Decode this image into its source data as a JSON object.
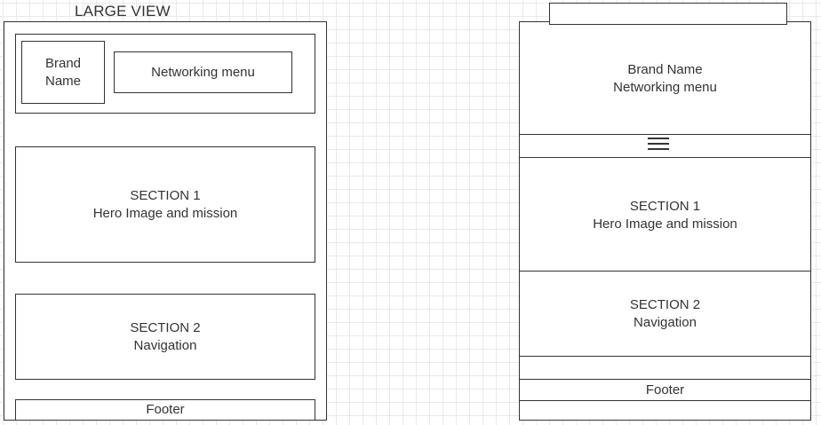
{
  "large_view": {
    "title": "LARGE VIEW",
    "header": {
      "brand_line1": "Brand",
      "brand_line2": "Name",
      "menu_label": "Networking menu"
    },
    "section1": {
      "title": "SECTION 1",
      "subtitle": "Hero Image and mission"
    },
    "section2": {
      "title": "SECTION 2",
      "subtitle": "Navigation"
    },
    "footer": "Footer"
  },
  "small_view": {
    "header": {
      "brand": "Brand Name",
      "menu_label": "Networking menu"
    },
    "menu_icon": "hamburger-icon",
    "section1": {
      "title": "SECTION 1",
      "subtitle": "Hero Image and mission"
    },
    "section2": {
      "title": "SECTION 2",
      "subtitle": "Navigation"
    },
    "footer": "Footer"
  }
}
